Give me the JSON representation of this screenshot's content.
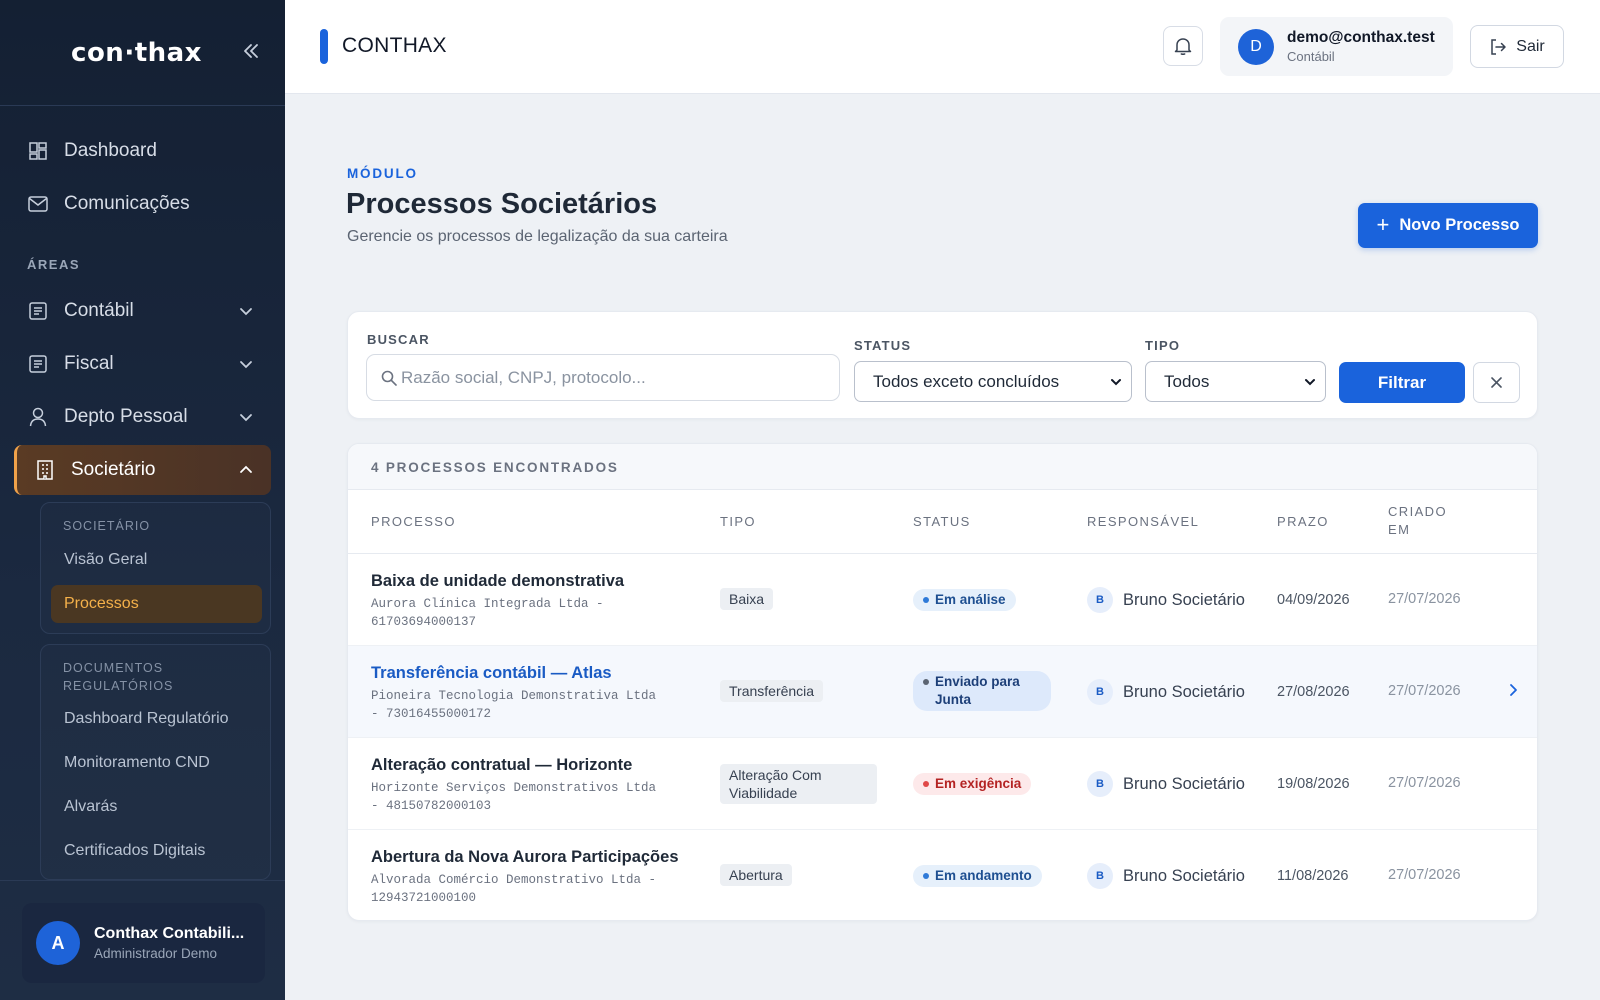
{
  "sidebar": {
    "logo": "con·thax",
    "nav": [
      {
        "label": "Dashboard"
      },
      {
        "label": "Comunicações"
      }
    ],
    "section_title": "ÁREAS",
    "areas": [
      {
        "label": "Contábil"
      },
      {
        "label": "Fiscal"
      },
      {
        "label": "Depto Pessoal"
      },
      {
        "label": "Societário"
      }
    ],
    "societario_group": {
      "title": "SOCIETÁRIO",
      "items": [
        {
          "label": "Visão Geral"
        },
        {
          "label": "Processos"
        }
      ]
    },
    "documentos_group": {
      "title_line1": "DOCUMENTOS",
      "title_line2": "REGULATÓRIOS",
      "items": [
        {
          "label": "Dashboard Regulatório"
        },
        {
          "label": "Monitoramento CND"
        },
        {
          "label": "Alvarás"
        },
        {
          "label": "Certificados Digitais"
        }
      ]
    },
    "profile": {
      "initial": "A",
      "name": "Conthax Contabili...",
      "role": "Administrador Demo"
    }
  },
  "topbar": {
    "title": "CONTHAX",
    "user_initial": "D",
    "user_email": "demo@conthax.test",
    "user_role": "Contábil",
    "logout_label": "Sair"
  },
  "page": {
    "eyebrow": "MÓDULO",
    "title": "Processos Societários",
    "subtitle": "Gerencie os processos de legalização da sua carteira",
    "new_button": "Novo Processo"
  },
  "filters": {
    "search_label": "BUSCAR",
    "search_placeholder": "Razão social, CNPJ, protocolo...",
    "status_label": "STATUS",
    "status_value": "Todos exceto concluídos",
    "type_label": "TIPO",
    "type_value": "Todos",
    "filter_button": "Filtrar"
  },
  "table": {
    "count_text": "4 PROCESSOS ENCONTRADOS",
    "headers": {
      "process": "PROCESSO",
      "type": "TIPO",
      "status": "STATUS",
      "responsible": "RESPONSÁVEL",
      "deadline": "PRAZO",
      "created_line1": "CRIADO",
      "created_line2": "EM"
    },
    "rows": [
      {
        "name": "Baixa de unidade demonstrativa",
        "company": "Aurora Clínica Integrada Ltda - 61703694000137",
        "type": "Baixa",
        "status": "Em análise",
        "resp_initial": "B",
        "responsible": "Bruno Societário",
        "deadline": "04/09/2026",
        "created": "27/07/2026"
      },
      {
        "name": "Transferência contábil — Atlas",
        "company": "Pioneira Tecnologia Demonstrativa Ltda - 73016455000172",
        "type": "Transferência",
        "status": "Enviado para Junta",
        "resp_initial": "B",
        "responsible": "Bruno Societário",
        "deadline": "27/08/2026",
        "created": "27/07/2026"
      },
      {
        "name": "Alteração contratual — Horizonte",
        "company": "Horizonte Serviços Demonstrativos Ltda - 48150782000103",
        "type": "Alteração Com Viabilidade",
        "status": "Em exigência",
        "resp_initial": "B",
        "responsible": "Bruno Societário",
        "deadline": "19/08/2026",
        "created": "27/07/2026"
      },
      {
        "name": "Abertura da Nova Aurora Participações",
        "company": "Alvorada Comércio Demonstrativo Ltda - 12943721000100",
        "type": "Abertura",
        "status": "Em andamento",
        "resp_initial": "B",
        "responsible": "Bruno Societário",
        "deadline": "11/08/2026",
        "created": "27/07/2026"
      }
    ]
  },
  "colors": {
    "primary": "#1a63dc",
    "sidebar_bg": "#142033",
    "active_accent": "#f0a24a",
    "danger": "#b42323"
  },
  "icons": {
    "collapse": "double-chevron-left-icon",
    "dashboard": "layout-grid-icon",
    "comunicacoes": "mail-icon",
    "contabil": "ledger-icon",
    "fiscal": "receipt-icon",
    "depto_pessoal": "user-icon",
    "societario": "building-icon",
    "bell": "bell-icon",
    "logout": "logout-icon",
    "search": "search-icon",
    "clear": "close-icon",
    "row": "chevron-right-icon"
  }
}
